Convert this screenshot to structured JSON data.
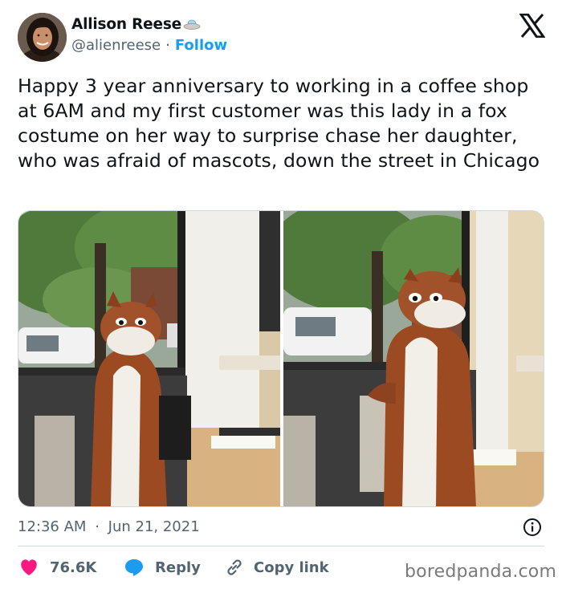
{
  "author": {
    "display_name": "Allison Reese",
    "handle": "@alienreese",
    "separator": "·",
    "follow_label": "Follow"
  },
  "tweet": {
    "text": "Happy 3 year anniversary to working in a coffee shop at 6AM and my first customer was this lady in a fox costume on her way to surprise chase her daughter, who was afraid of mascots, down the street in Chicago"
  },
  "meta": {
    "time": "12:36 AM",
    "separator": "·",
    "date": "Jun 21, 2021"
  },
  "actions": {
    "like_count": "76.6K",
    "reply_label": "Reply",
    "copy_label": "Copy link"
  },
  "watermark": "boredpanda.com",
  "colors": {
    "accent": "#1d9bf0",
    "like": "#f91880",
    "secondary_text": "#536471",
    "primary_text": "#0f1419"
  },
  "icons": [
    "x-logo-icon",
    "ufo-badge-icon",
    "heart-icon",
    "reply-bubble-icon",
    "link-icon",
    "info-icon"
  ]
}
